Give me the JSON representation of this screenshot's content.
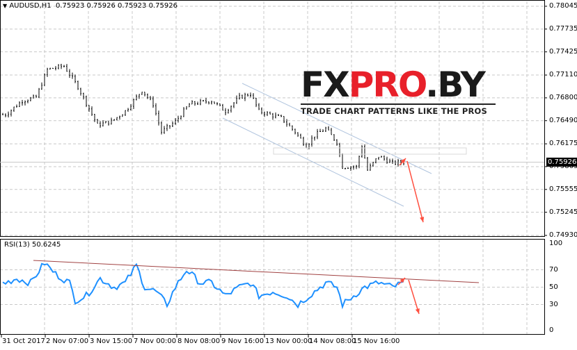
{
  "header": {
    "arrow_icon": "triangle-down-icon",
    "title": "AUDUSD,H1  0.75923 0.75926 0.75923 0.75926"
  },
  "price_axis": {
    "labels": [
      "0.78045",
      "0.77735",
      "0.77425",
      "0.77110",
      "0.76800",
      "0.76490",
      "0.76175",
      "0.75865",
      "0.75555",
      "0.75245",
      "0.74930"
    ],
    "current": "0.75926"
  },
  "rsi": {
    "title": "RSI(13) 50.6245",
    "labels": [
      "100",
      "70",
      "50",
      "30",
      "0"
    ]
  },
  "time_axis": {
    "labels": [
      "31 Oct 2017",
      "2 Nov 07:00",
      "3 Nov 15:00",
      "7 Nov 00:00",
      "8 Nov 08:00",
      "9 Nov 16:00",
      "13 Nov 00:00",
      "14 Nov 08:00",
      "15 Nov 16:00"
    ]
  },
  "logo": {
    "part1": "FX",
    "part2": "PRO",
    "part3": ".BY",
    "tagline": "TRADE CHART PATTERNS LIKE THE PROS"
  },
  "colors": {
    "candle": "#000000",
    "rsi": "#1e90ff",
    "channel": "#b0c4de",
    "arrow": "#ff5040",
    "rsi_trend": "#a04040",
    "grid": "#c8c8c8"
  },
  "chart_data": {
    "type": "candlestick",
    "symbol": "AUDUSD",
    "timeframe": "H1",
    "ylim": [
      0.7493,
      0.78045
    ],
    "close_anchors": [
      [
        1,
        0.76572
      ],
      [
        7,
        0.76761
      ],
      [
        12,
        0.76808
      ],
      [
        16,
        0.77186
      ],
      [
        22,
        0.77233
      ],
      [
        27,
        0.7695
      ],
      [
        34,
        0.76431
      ],
      [
        39,
        0.76478
      ],
      [
        44,
        0.7662
      ],
      [
        50,
        0.76903
      ],
      [
        54,
        0.76714
      ],
      [
        57,
        0.76336
      ],
      [
        62,
        0.76478
      ],
      [
        67,
        0.76714
      ],
      [
        75,
        0.76761
      ],
      [
        80,
        0.7662
      ],
      [
        85,
        0.76808
      ],
      [
        89,
        0.76856
      ],
      [
        92,
        0.7662
      ],
      [
        100,
        0.76525
      ],
      [
        105,
        0.76336
      ],
      [
        109,
        0.76148
      ],
      [
        112,
        0.76289
      ],
      [
        116,
        0.76384
      ],
      [
        120,
        0.76195
      ],
      [
        122,
        0.75864
      ],
      [
        127,
        0.75864
      ],
      [
        129,
        0.76148
      ],
      [
        131,
        0.75817
      ],
      [
        135,
        0.76006
      ],
      [
        140,
        0.75912
      ],
      [
        144,
        0.75926
      ]
    ],
    "rsi_period": 13,
    "rsi_ylim": [
      0,
      100
    ],
    "rsi_levels": [
      70,
      50,
      30
    ],
    "rsi_anchors": [
      [
        1,
        55
      ],
      [
        5,
        60
      ],
      [
        10,
        55
      ],
      [
        15,
        78
      ],
      [
        19,
        65
      ],
      [
        24,
        55
      ],
      [
        26,
        35
      ],
      [
        30,
        40
      ],
      [
        35,
        60
      ],
      [
        40,
        50
      ],
      [
        44,
        55
      ],
      [
        48,
        75
      ],
      [
        51,
        50
      ],
      [
        55,
        45
      ],
      [
        59,
        30
      ],
      [
        62,
        50
      ],
      [
        66,
        70
      ],
      [
        71,
        55
      ],
      [
        75,
        55
      ],
      [
        80,
        40
      ],
      [
        85,
        50
      ],
      [
        89,
        55
      ],
      [
        92,
        40
      ],
      [
        97,
        45
      ],
      [
        102,
        40
      ],
      [
        106,
        30
      ],
      [
        110,
        40
      ],
      [
        116,
        55
      ],
      [
        120,
        50
      ],
      [
        122,
        30
      ],
      [
        126,
        40
      ],
      [
        130,
        50
      ],
      [
        135,
        55
      ],
      [
        140,
        50
      ],
      [
        144,
        55
      ]
    ],
    "rsi_value": 50.6245
  }
}
